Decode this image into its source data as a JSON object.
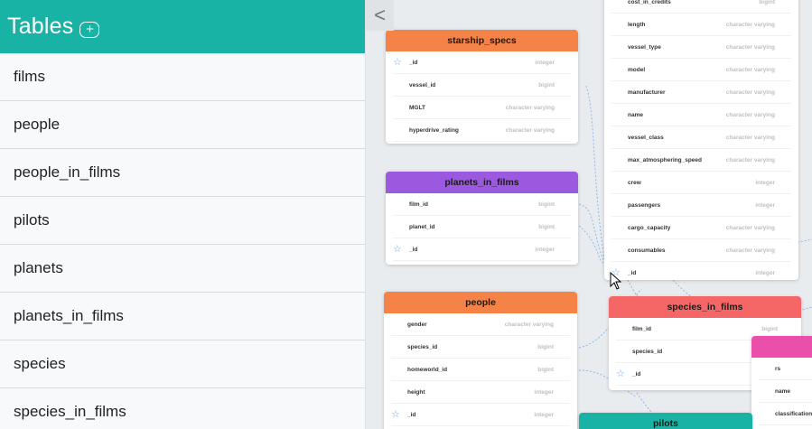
{
  "sidebar": {
    "title": "Tables",
    "add_icon": "plus-icon",
    "items": [
      {
        "label": "films"
      },
      {
        "label": "people"
      },
      {
        "label": "people_in_films"
      },
      {
        "label": "pilots"
      },
      {
        "label": "planets"
      },
      {
        "label": "planets_in_films"
      },
      {
        "label": "species"
      },
      {
        "label": "species_in_films"
      }
    ]
  },
  "collapse": {
    "label": "<"
  },
  "colors": {
    "header": "#19b3a6",
    "starship_specs": "#f58246",
    "planets_in_films": "#9b59e0",
    "people": "#f58246",
    "species_in_films": "#f56667",
    "pilots": "#19b3a6",
    "partial": "#ea4faa"
  },
  "cards": {
    "vessels": {
      "rows": [
        {
          "name": "cost_in_credits",
          "type": "bigint"
        },
        {
          "name": "length",
          "type": "character varying"
        },
        {
          "name": "vessel_type",
          "type": "character varying"
        },
        {
          "name": "model",
          "type": "character varying"
        },
        {
          "name": "manufacturer",
          "type": "character varying"
        },
        {
          "name": "name",
          "type": "character varying"
        },
        {
          "name": "vessel_class",
          "type": "character varying"
        },
        {
          "name": "max_atmosphering_speed",
          "type": "character varying"
        },
        {
          "name": "crew",
          "type": "integer"
        },
        {
          "name": "passengers",
          "type": "integer"
        },
        {
          "name": "cargo_capacity",
          "type": "character varying"
        },
        {
          "name": "consumables",
          "type": "character varying"
        },
        {
          "name": "_id",
          "type": "integer"
        }
      ]
    },
    "starship_specs": {
      "title": "starship_specs",
      "rows": [
        {
          "name": "_id",
          "type": "integer"
        },
        {
          "name": "vessel_id",
          "type": "bigint"
        },
        {
          "name": "MGLT",
          "type": "character varying"
        },
        {
          "name": "hyperdrive_rating",
          "type": "character varying"
        }
      ]
    },
    "planets_in_films": {
      "title": "planets_in_films",
      "rows": [
        {
          "name": "film_id",
          "type": "bigint"
        },
        {
          "name": "planet_id",
          "type": "bigint"
        },
        {
          "name": "_id",
          "type": "integer"
        }
      ]
    },
    "people": {
      "title": "people",
      "rows": [
        {
          "name": "gender",
          "type": "character varying"
        },
        {
          "name": "species_id",
          "type": "bigint"
        },
        {
          "name": "homeworld_id",
          "type": "bigint"
        },
        {
          "name": "height",
          "type": "integer"
        },
        {
          "name": "_id",
          "type": "integer"
        }
      ]
    },
    "species_in_films": {
      "title": "species_in_films",
      "rows": [
        {
          "name": "film_id",
          "type": "bigint"
        },
        {
          "name": "species_id",
          "type": "bigint"
        },
        {
          "name": "_id",
          "type": "integer"
        }
      ]
    },
    "pilots": {
      "title": "pilots"
    },
    "partial": {
      "rows": [
        {
          "name": "rs",
          "type": ""
        },
        {
          "name": "name",
          "type": ""
        },
        {
          "name": "classification",
          "type": ""
        }
      ]
    }
  }
}
